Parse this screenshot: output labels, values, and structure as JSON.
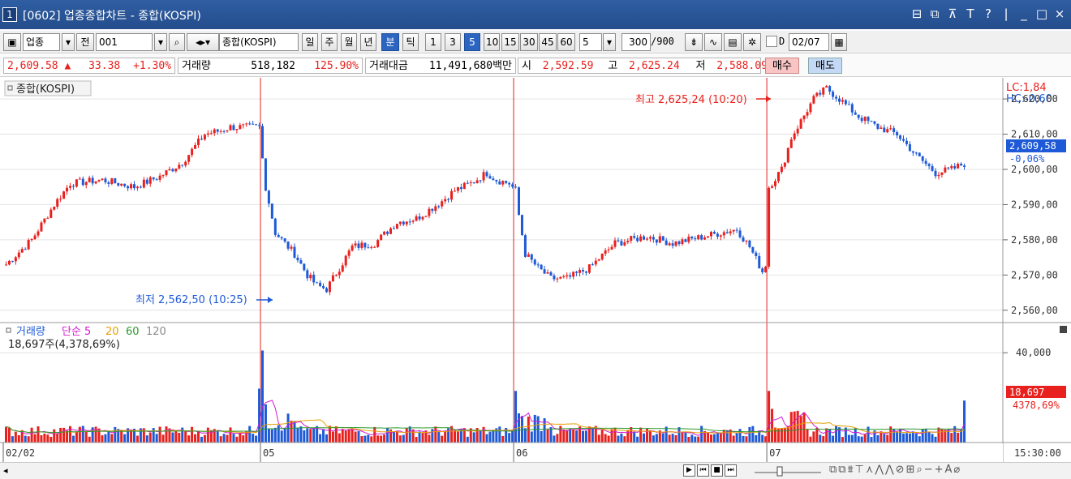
{
  "window": {
    "number": "1",
    "title": "[0602] 업종종합차트 - 종합(KOSPI)",
    "controls": [
      "⊟",
      "⧉",
      "⊼",
      "T",
      "?",
      "|",
      "_",
      "□",
      "×"
    ]
  },
  "toolbar": {
    "sector_label": "업종",
    "whole_label": "전",
    "code": "001",
    "name": "종합(KOSPI)",
    "periods": [
      "일",
      "주",
      "월",
      "년",
      "분",
      "틱"
    ],
    "minutes": [
      "1",
      "3",
      "5",
      "10",
      "15",
      "30",
      "45",
      "60"
    ],
    "active_minute": "5",
    "active_period": "분",
    "interval_value": "5",
    "count": "300",
    "total": "/900",
    "checkbox_label": "D",
    "date": "02/07"
  },
  "quote": {
    "price": "2,609.58",
    "direction": "▲",
    "change": "33.38",
    "change_pct": "+1.30%",
    "volume_label": "거래량",
    "volume": "518,182",
    "volume_ratio": "125.90%",
    "amount_label": "거래대금",
    "amount": "11,491,680백만",
    "open_label": "시",
    "open": "2,592.59",
    "high_label": "고",
    "high": "2,625.24",
    "low_label": "저",
    "low": "2,588.09",
    "buy_label": "매수",
    "sell_label": "매도"
  },
  "chart": {
    "price_title": "종합(KOSPI)",
    "lc": "LC:1,84",
    "hc": "HC:-0,60",
    "current_price": "2,609,58",
    "current_change": "-0,06%",
    "high_annotation": "최고 2,625,24 (10:20)",
    "low_annotation": "최저 2,562,50 (10:25)",
    "volume_title": "거래량",
    "ma_labels": [
      {
        "text": "단순 5",
        "color": "#d21cd2"
      },
      {
        "text": "20",
        "color": "#e6a000"
      },
      {
        "text": "60",
        "color": "#2a9a2a"
      },
      {
        "text": "120",
        "color": "#888888"
      }
    ],
    "volume_info": "18,697주(4,378,69%)",
    "current_volume": "18,697",
    "current_volume_pct": "4378,69%",
    "x_labels": [
      "02/02",
      "05",
      "06",
      "07"
    ],
    "time_label": "15:30:00",
    "colors": {
      "up": "#e8211e",
      "down": "#1e5ad7",
      "divider": "#e8211e"
    }
  },
  "chart_data": {
    "type": "candlestick",
    "y_ticks": [
      "2,620,00",
      "2,610,00",
      "2,600,00",
      "2,590,00",
      "2,580,00",
      "2,570,00",
      "2,560,00"
    ],
    "y_values": [
      2620,
      2610,
      2600,
      2590,
      2580,
      2570,
      2560
    ],
    "ylim": [
      2556.5,
      2626
    ],
    "volume_ticks": [
      "40,000"
    ],
    "volume_tick_values": [
      40000
    ],
    "volume_ylim": [
      0,
      52000
    ],
    "bar_count": 300,
    "day_boundaries": [
      0,
      80,
      159,
      238
    ],
    "price_path": [
      [
        0,
        2573
      ],
      [
        8,
        2580
      ],
      [
        15,
        2590
      ],
      [
        20,
        2596
      ],
      [
        30,
        2597
      ],
      [
        40,
        2595
      ],
      [
        48,
        2598
      ],
      [
        55,
        2602
      ],
      [
        62,
        2610
      ],
      [
        67,
        2611
      ],
      [
        70,
        2612
      ],
      [
        79,
        2612
      ],
      [
        80,
        2603
      ],
      [
        81,
        2595
      ],
      [
        84,
        2582
      ],
      [
        90,
        2576
      ],
      [
        94,
        2570
      ],
      [
        97,
        2567
      ],
      [
        100,
        2566
      ],
      [
        104,
        2572
      ],
      [
        108,
        2578
      ],
      [
        115,
        2579
      ],
      [
        122,
        2585
      ],
      [
        128,
        2586
      ],
      [
        136,
        2591
      ],
      [
        140,
        2594
      ],
      [
        145,
        2596
      ],
      [
        150,
        2599
      ],
      [
        153,
        2597
      ],
      [
        157,
        2596
      ],
      [
        159,
        2594
      ],
      [
        160,
        2587
      ],
      [
        162,
        2576
      ],
      [
        166,
        2572
      ],
      [
        170,
        2569
      ],
      [
        175,
        2569
      ],
      [
        182,
        2572
      ],
      [
        190,
        2579
      ],
      [
        200,
        2581
      ],
      [
        208,
        2579
      ],
      [
        218,
        2581
      ],
      [
        228,
        2583
      ],
      [
        232,
        2578
      ],
      [
        236,
        2571
      ],
      [
        237,
        2573
      ],
      [
        238,
        2595
      ],
      [
        242,
        2600
      ],
      [
        245,
        2609
      ],
      [
        252,
        2620
      ],
      [
        256,
        2623
      ],
      [
        260,
        2620
      ],
      [
        266,
        2615
      ],
      [
        272,
        2612
      ],
      [
        278,
        2610
      ],
      [
        284,
        2604
      ],
      [
        290,
        2599
      ],
      [
        295,
        2600
      ],
      [
        300,
        2602
      ],
      [
        305,
        2607
      ],
      [
        310,
        2610
      ]
    ],
    "volume_baseline": 5000,
    "volume_spikes": [
      {
        "bar": 80,
        "value": 41000
      },
      {
        "bar": 79,
        "value": 24000
      },
      {
        "bar": 81,
        "value": 17000
      },
      {
        "bar": 159,
        "value": 23000
      },
      {
        "bar": 160,
        "value": 13000
      },
      {
        "bar": 238,
        "value": 23000
      },
      {
        "bar": 239,
        "value": 15000
      },
      {
        "bar": 299,
        "value": 18697
      }
    ]
  }
}
